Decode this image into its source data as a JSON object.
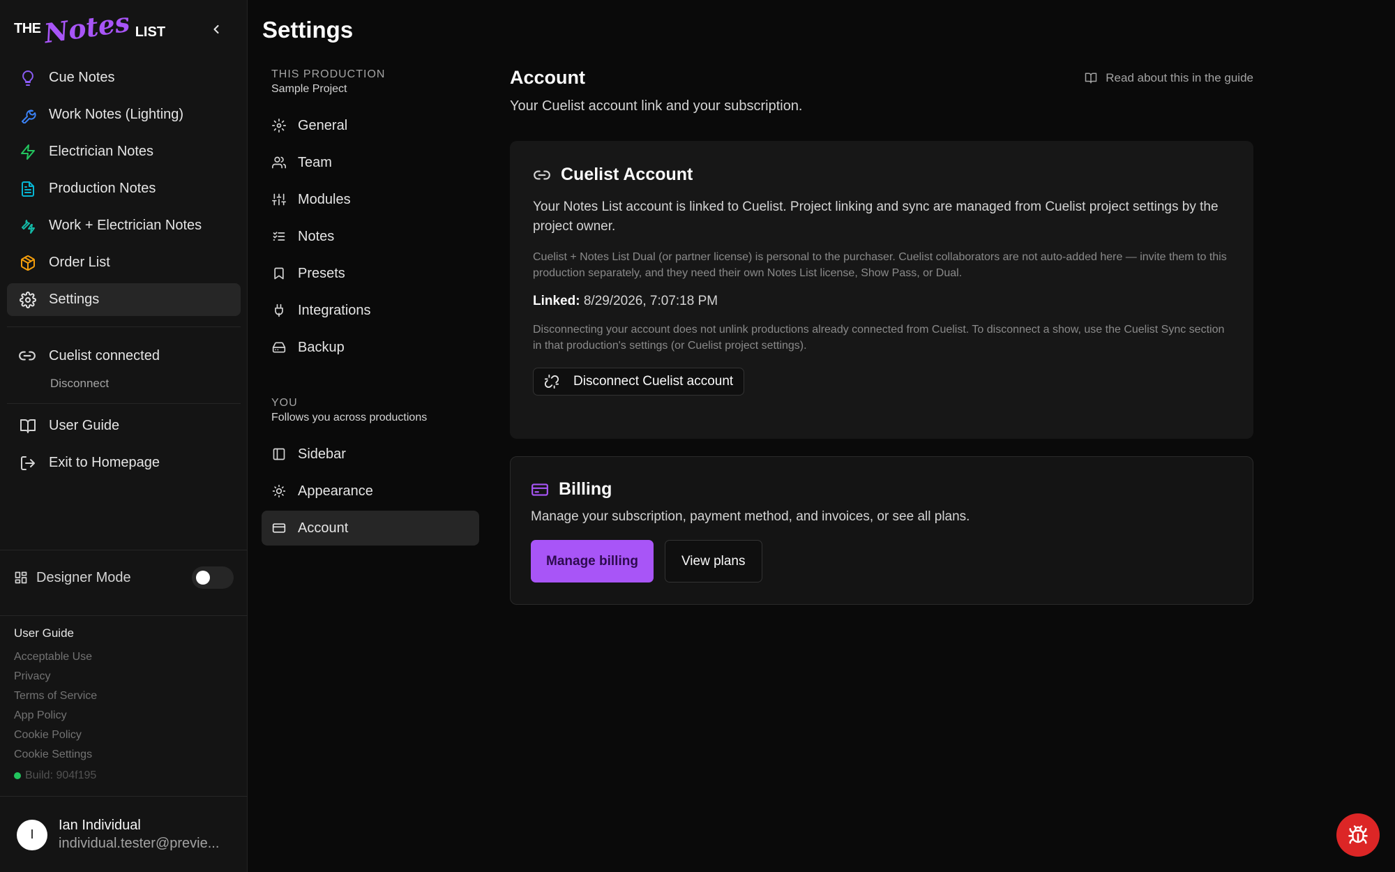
{
  "logo": {
    "the": "THE",
    "notes": "Notes",
    "list": "LIST"
  },
  "sidebar": {
    "items": [
      {
        "label": "Cue Notes",
        "icon": "lightbulb-icon"
      },
      {
        "label": "Work Notes (Lighting)",
        "icon": "wrench-icon"
      },
      {
        "label": "Electrician Notes",
        "icon": "zap-icon"
      },
      {
        "label": "Production Notes",
        "icon": "file-text-icon"
      },
      {
        "label": "Work + Electrician Notes",
        "icon": "wrench-zap-icon"
      },
      {
        "label": "Order List",
        "icon": "package-icon"
      },
      {
        "label": "Settings",
        "icon": "gear-icon"
      }
    ],
    "cuelist_status": "Cuelist connected",
    "disconnect": "Disconnect",
    "user_guide": "User Guide",
    "exit": "Exit to Homepage",
    "designer_mode": "Designer Mode",
    "designer_mode_on": false,
    "footer": {
      "heading": "User Guide",
      "links": [
        "Acceptable Use",
        "Privacy",
        "Terms of Service",
        "App Policy",
        "Cookie Policy",
        "Cookie Settings"
      ],
      "build": "Build: 904f195"
    },
    "user": {
      "initial": "I",
      "name": "Ian Individual",
      "email": "individual.tester@previe..."
    }
  },
  "settings": {
    "title": "Settings",
    "production_heading": "THIS PRODUCTION",
    "production_name": "Sample Project",
    "production_items": [
      "General",
      "Team",
      "Modules",
      "Notes",
      "Presets",
      "Integrations",
      "Backup"
    ],
    "you_heading": "YOU",
    "you_sub": "Follows you across productions",
    "you_items": [
      "Sidebar",
      "Appearance",
      "Account"
    ]
  },
  "main": {
    "title": "Account",
    "subtitle": "Your Cuelist account link and your subscription.",
    "guide_link": "Read about this in the guide",
    "cuelist_card": {
      "title": "Cuelist Account",
      "body": "Your Notes List account is linked to Cuelist. Project linking and sync are managed from Cuelist project settings by the project owner.",
      "note": "Cuelist + Notes List Dual (or partner license) is personal to the purchaser. Cuelist collaborators are not auto-added here — invite them to this production separately, and they need their own Notes List license, Show Pass, or Dual.",
      "linked_label": "Linked:",
      "linked_value": "8/29/2026, 7:07:18 PM",
      "disconnect_note": "Disconnecting your account does not unlink productions already connected from Cuelist. To disconnect a show, use the Cuelist Sync section in that production's settings (or Cuelist project settings).",
      "disconnect_button": "Disconnect Cuelist account"
    },
    "billing_card": {
      "title": "Billing",
      "body": "Manage your subscription, payment method, and invoices, or see all plans.",
      "manage_button": "Manage billing",
      "plans_button": "View plans"
    }
  },
  "colors": {
    "accent": "#a855f7",
    "background": "#0a0a0a",
    "sidebar": "#141414",
    "bug_button": "#dc2626",
    "build_status": "#22c55e"
  }
}
